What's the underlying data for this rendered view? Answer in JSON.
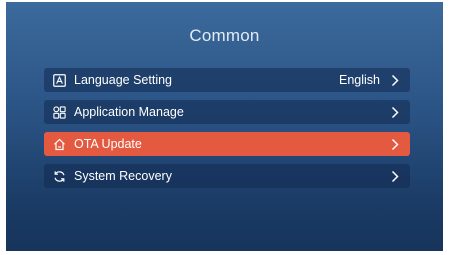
{
  "header": {
    "title": "Common"
  },
  "menu": {
    "items": [
      {
        "label": "Language Setting",
        "value": "English",
        "icon": "language-icon"
      },
      {
        "label": "Application Manage",
        "value": "",
        "icon": "apps-grid-icon"
      },
      {
        "label": "OTA Update",
        "value": "",
        "icon": "home-update-icon",
        "selected": true
      },
      {
        "label": "System Recovery",
        "value": "",
        "icon": "refresh-icon"
      }
    ]
  },
  "colors": {
    "background_top": "#3c6a9c",
    "background_bottom": "#17345b",
    "row_background": "#1a3766",
    "selected_accent": "#e35a40"
  }
}
